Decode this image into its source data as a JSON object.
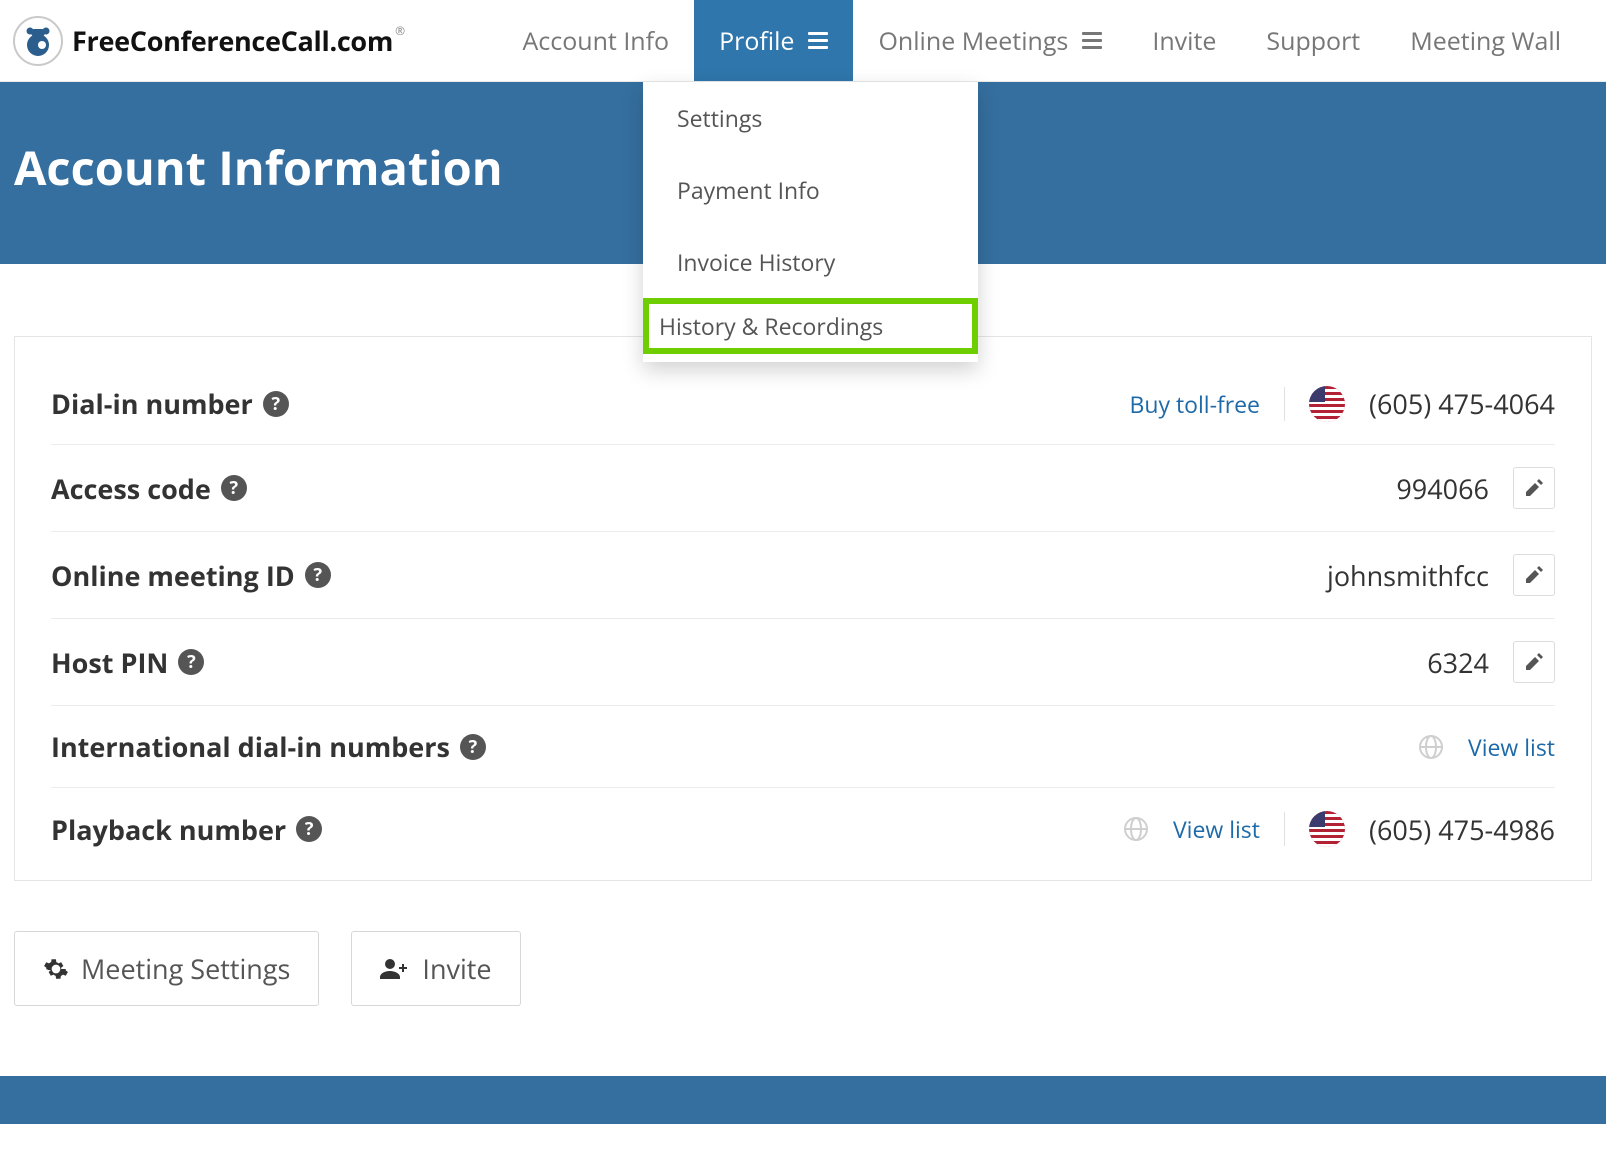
{
  "brand": {
    "text": "FreeConferenceCall.com"
  },
  "nav": {
    "account_info": "Account Info",
    "profile": "Profile",
    "online_meetings": "Online Meetings",
    "invite": "Invite",
    "support": "Support",
    "meeting_wall": "Meeting Wall"
  },
  "dropdown": {
    "settings": "Settings",
    "payment_info": "Payment Info",
    "invoice_history": "Invoice History",
    "history_recordings": "History & Recordings"
  },
  "hero": {
    "title": "Account Information"
  },
  "rows": {
    "dial_in": {
      "label": "Dial-in number",
      "buy_link": "Buy toll-free",
      "value": "(605) 475-4064"
    },
    "access_code": {
      "label": "Access code",
      "value": "994066"
    },
    "meeting_id": {
      "label": "Online meeting ID",
      "value": "johnsmithfcc"
    },
    "host_pin": {
      "label": "Host PIN",
      "value": "6324"
    },
    "intl": {
      "label": "International dial-in numbers",
      "view_list": "View list"
    },
    "playback": {
      "label": "Playback number",
      "view_list": "View list",
      "value": "(605) 475-4986"
    }
  },
  "buttons": {
    "meeting_settings": "Meeting Settings",
    "invite": "Invite"
  }
}
